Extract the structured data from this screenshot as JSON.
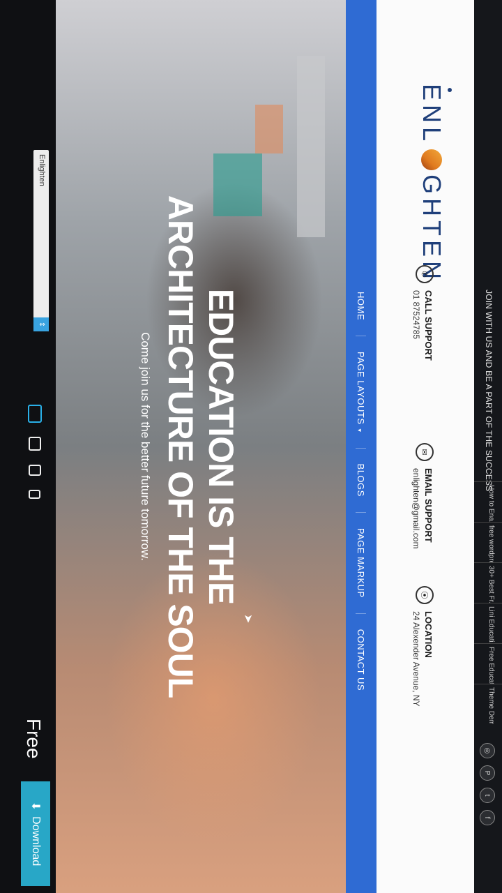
{
  "topbar": {
    "message": "JOIN WITH US AND BE A PART OF THE SUCCESS",
    "tabs": [
      "How to Ena...",
      "free wordpre...",
      "30+ Best Fr...",
      "Lini Educati...",
      "Free Educat...",
      "Theme Dem..."
    ]
  },
  "social_icons": [
    "instagram-icon",
    "pinterest-icon",
    "twitter-icon",
    "facebook-icon"
  ],
  "logo": {
    "text": "ENLIGHTEN",
    "part1": "ENL",
    "part2": "GHTEN"
  },
  "contacts": [
    {
      "title": "CALL SUPPORT",
      "value": "01 87524785",
      "icon": "phone-icon"
    },
    {
      "title": "EMAIL SUPPORT",
      "value": "enlighten@gmail.com",
      "icon": "mail-icon"
    },
    {
      "title": "LOCATION",
      "value": "24 Alexender Avenue, NY",
      "icon": "location-icon"
    }
  ],
  "nav": {
    "items": [
      "HOME",
      "PAGE LAYOUTS",
      "BLOGS",
      "PAGE MARKUP",
      "CONTACT US"
    ],
    "dropdown_caret": "▾"
  },
  "hero": {
    "line1": "EDUCATION IS THE",
    "line2": "ARCHITECTURE OF THE SOUL",
    "subtitle": "Come join us for the better future tomorrow."
  },
  "toolbar": {
    "theme_select": "Enlighten",
    "free_label": "Free",
    "download_label": "Download"
  },
  "colors": {
    "nav_blue": "#2f6bd3",
    "logo_navy": "#1f3f7a",
    "download_teal": "#28a7c7"
  }
}
